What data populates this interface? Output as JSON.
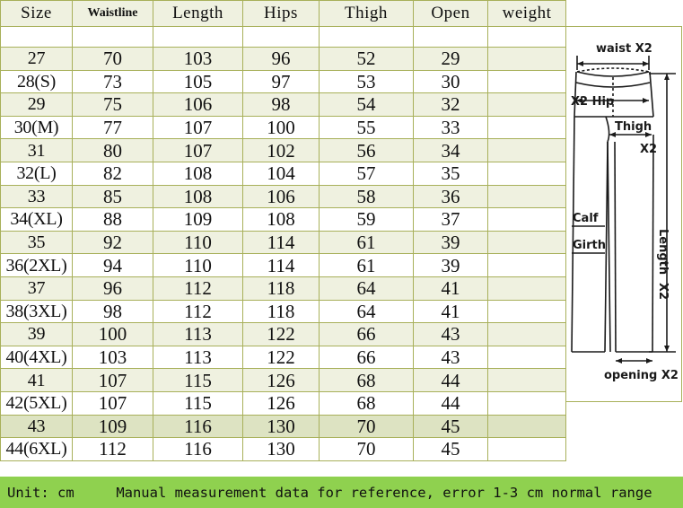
{
  "table": {
    "columns": [
      "Size",
      "Waistline",
      "Length",
      "Hips",
      "Thigh",
      "Open",
      "weight"
    ],
    "rows": [
      {
        "size": "27",
        "waistline": "70",
        "length": "103",
        "hips": "96",
        "thigh": "52",
        "open": "29",
        "weight": ""
      },
      {
        "size": "28(S)",
        "waistline": "73",
        "length": "105",
        "hips": "97",
        "thigh": "53",
        "open": "30",
        "weight": ""
      },
      {
        "size": "29",
        "waistline": "75",
        "length": "106",
        "hips": "98",
        "thigh": "54",
        "open": "32",
        "weight": ""
      },
      {
        "size": "30(M)",
        "waistline": "77",
        "length": "107",
        "hips": "100",
        "thigh": "55",
        "open": "33",
        "weight": ""
      },
      {
        "size": "31",
        "waistline": "80",
        "length": "107",
        "hips": "102",
        "thigh": "56",
        "open": "34",
        "weight": ""
      },
      {
        "size": "32(L)",
        "waistline": "82",
        "length": "108",
        "hips": "104",
        "thigh": "57",
        "open": "35",
        "weight": ""
      },
      {
        "size": "33",
        "waistline": "85",
        "length": "108",
        "hips": "106",
        "thigh": "58",
        "open": "36",
        "weight": ""
      },
      {
        "size": "34(XL)",
        "waistline": "88",
        "length": "109",
        "hips": "108",
        "thigh": "59",
        "open": "37",
        "weight": ""
      },
      {
        "size": "35",
        "waistline": "92",
        "length": "110",
        "hips": "114",
        "thigh": "61",
        "open": "39",
        "weight": ""
      },
      {
        "size": "36(2XL)",
        "waistline": "94",
        "length": "110",
        "hips": "114",
        "thigh": "61",
        "open": "39",
        "weight": ""
      },
      {
        "size": "37",
        "waistline": "96",
        "length": "112",
        "hips": "118",
        "thigh": "64",
        "open": "41",
        "weight": ""
      },
      {
        "size": "38(3XL)",
        "waistline": "98",
        "length": "112",
        "hips": "118",
        "thigh": "64",
        "open": "41",
        "weight": ""
      },
      {
        "size": "39",
        "waistline": "100",
        "length": "113",
        "hips": "122",
        "thigh": "66",
        "open": "43",
        "weight": ""
      },
      {
        "size": "40(4XL)",
        "waistline": "103",
        "length": "113",
        "hips": "122",
        "thigh": "66",
        "open": "43",
        "weight": ""
      },
      {
        "size": "41",
        "waistline": "107",
        "length": "115",
        "hips": "126",
        "thigh": "68",
        "open": "44",
        "weight": ""
      },
      {
        "size": "42(5XL)",
        "waistline": "107",
        "length": "115",
        "hips": "126",
        "thigh": "68",
        "open": "44",
        "weight": ""
      },
      {
        "size": "43",
        "waistline": "109",
        "length": "116",
        "hips": "130",
        "thigh": "70",
        "open": "45",
        "weight": ""
      },
      {
        "size": "44(6XL)",
        "waistline": "112",
        "length": "116",
        "hips": "130",
        "thigh": "70",
        "open": "45",
        "weight": ""
      }
    ],
    "highlighted_row_index": 16
  },
  "diagram": {
    "name": "trousers-measurement-diagram",
    "labels": {
      "waist": "waist X2",
      "hip": "X2 Hip",
      "thigh": "Thigh",
      "thigh_x2": "X2",
      "calf": "Calf",
      "girth": "Girth",
      "length": "Length",
      "length_x2": "X2",
      "opening": "opening X2"
    }
  },
  "footer": {
    "unit": "Unit: cm",
    "note": "Manual measurement data for reference, error 1-3 cm normal range",
    "text": "Unit: cm     Manual measurement data for reference, error 1-3 cm normal range"
  },
  "colors": {
    "grid_line": "#a8b05a",
    "row_tint": "#eff1e0",
    "row_highlight": "#dde3c2",
    "footer_bg": "#8fd14f",
    "text": "#111111"
  }
}
